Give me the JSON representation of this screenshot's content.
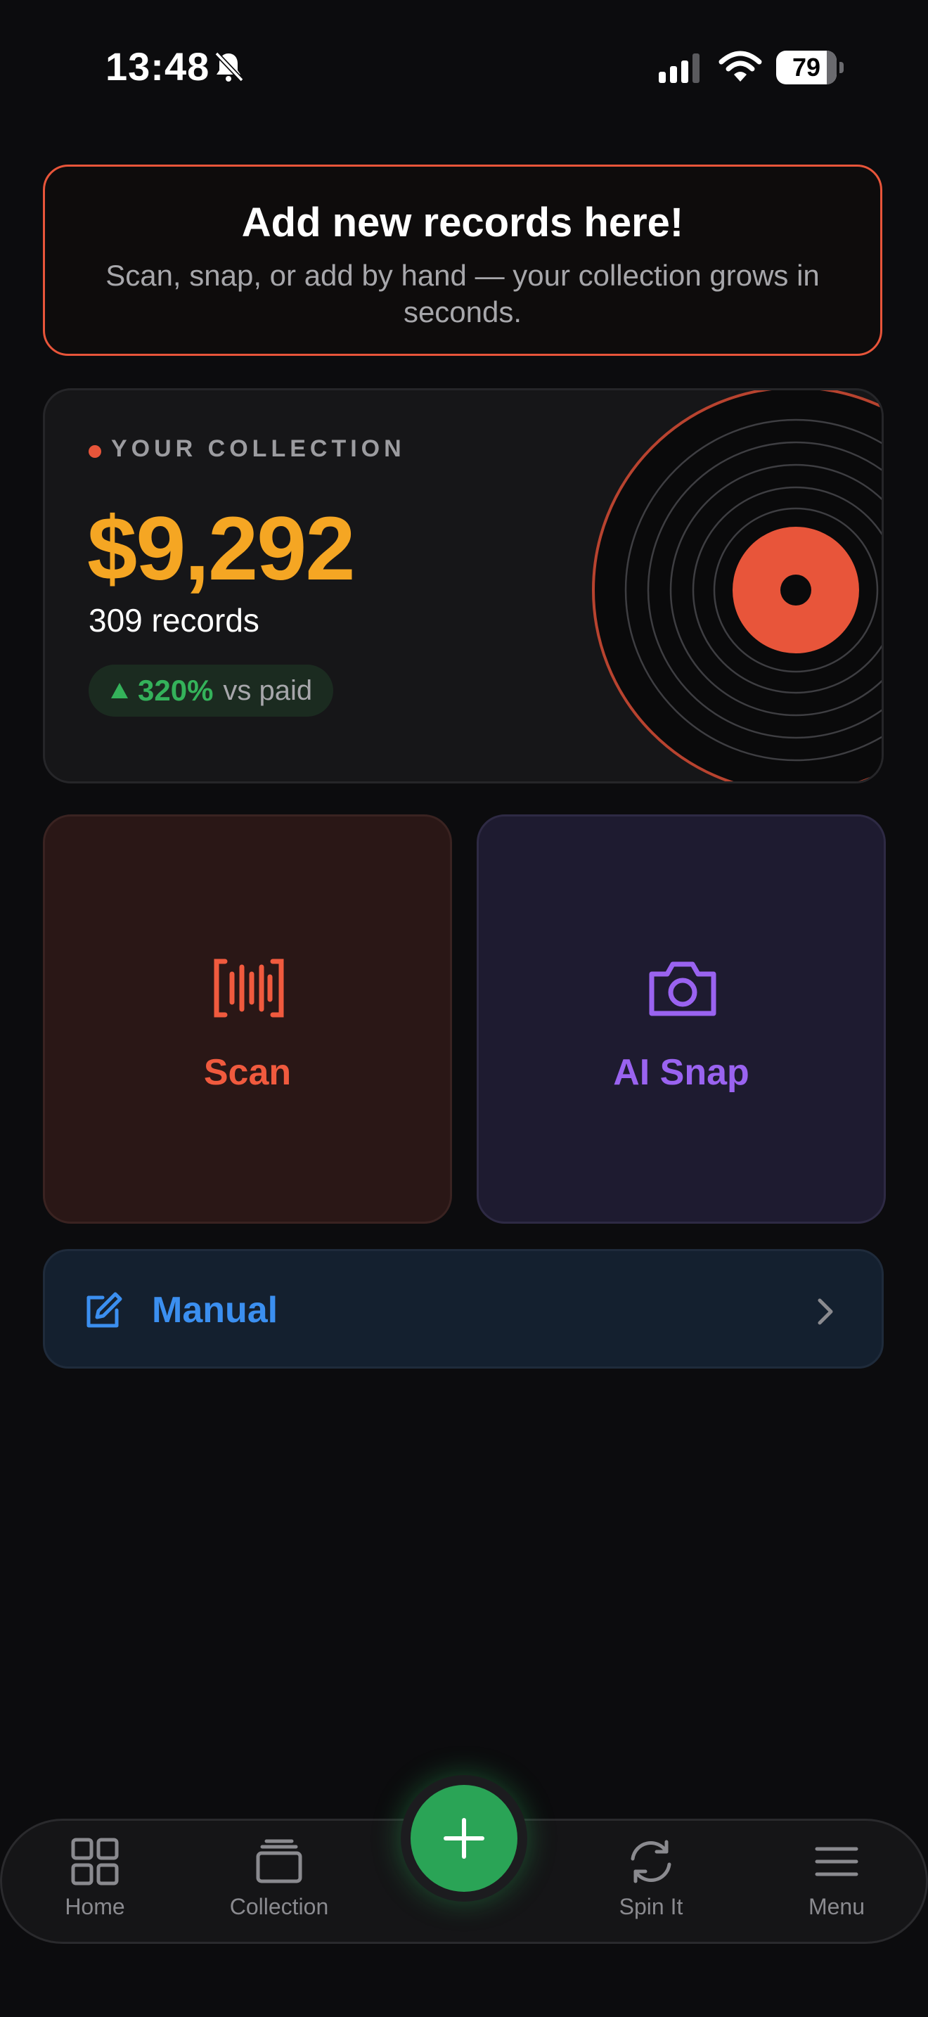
{
  "status_bar": {
    "time": "13:48",
    "battery": "79"
  },
  "banner": {
    "title": "Add new records here!",
    "subtitle": "Scan, snap, or add by hand — your collection grows in seconds."
  },
  "collection": {
    "label": "YOUR COLLECTION",
    "value": "$9,292",
    "record_count": "309 records",
    "growth_pct": "320%",
    "growth_suffix": "vs paid"
  },
  "actions": {
    "scan_label": "Scan",
    "snap_label": "AI Snap",
    "manual_label": "Manual"
  },
  "tabbar": {
    "items": [
      {
        "label": "Home",
        "icon": "grid-icon"
      },
      {
        "label": "Collection",
        "icon": "stack-icon"
      },
      {
        "label": "Spin It",
        "icon": "refresh-icon"
      },
      {
        "label": "Menu",
        "icon": "hamburger-icon"
      }
    ],
    "fab_icon": "plus-icon"
  },
  "colors": {
    "accent_red": "#e8553a",
    "accent_gold": "#f5a623",
    "accent_green": "#34b25a",
    "accent_purple": "#9a63f0",
    "accent_blue": "#3b8ff0",
    "background": "#0c0c0e"
  }
}
